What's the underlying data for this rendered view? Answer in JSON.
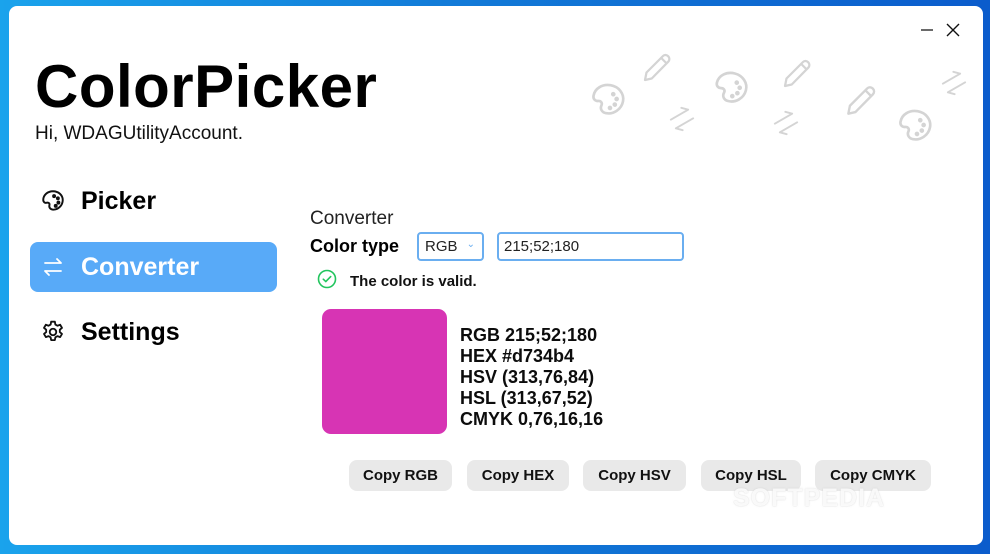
{
  "window": {
    "controls": {
      "minimize_icon": "minimize-icon",
      "close_icon": "close-icon"
    }
  },
  "header": {
    "title": "ColorPicker",
    "greeting": "Hi, WDAGUtilityAccount."
  },
  "sidebar": {
    "items": [
      {
        "label": "Picker",
        "icon": "palette-icon",
        "active": false
      },
      {
        "label": "Converter",
        "icon": "swap-arrows-icon",
        "active": true
      },
      {
        "label": "Settings",
        "icon": "gear-icon",
        "active": false
      }
    ]
  },
  "converter": {
    "section_title": "Converter",
    "color_type_label": "Color type",
    "color_type_selected": "RGB",
    "value_input": "215;52;180",
    "validation_message": "The color is valid.",
    "swatch_color": "#d734b4",
    "values": {
      "rgb": "RGB 215;52;180",
      "hex": "HEX #d734b4",
      "hsv": "HSV (313,76,84)",
      "hsl": "HSL (313,67,52)",
      "cmyk": "CMYK 0,76,16,16"
    },
    "buttons": {
      "copy_rgb": "Copy RGB",
      "copy_hex": "Copy HEX",
      "copy_hsv": "Copy HSV",
      "copy_hsl": "Copy HSL",
      "copy_cmyk": "Copy CMYK"
    }
  },
  "colors": {
    "accent": "#58aaf8",
    "input_border": "#6aaef0",
    "valid_green": "#22c55e",
    "button_bg": "#e9e9e9",
    "doodle_gray": "#d4d4d4"
  },
  "watermark": "SOFTPEDIA"
}
